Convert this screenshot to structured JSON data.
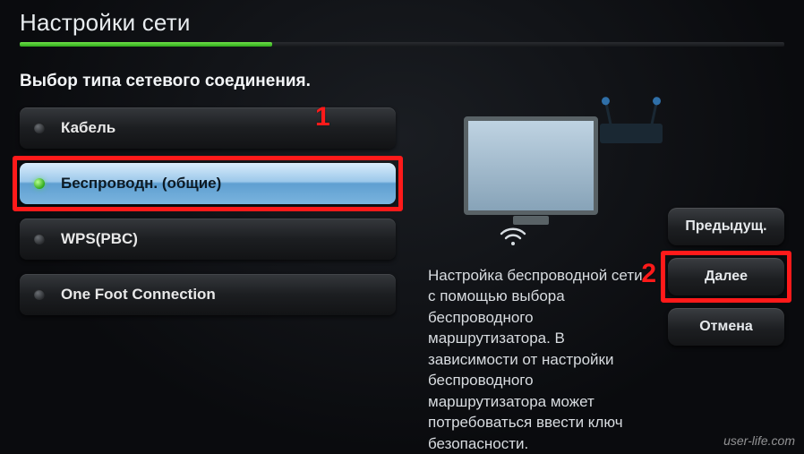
{
  "title": "Настройки сети",
  "subtitle": "Выбор типа сетевого соединения.",
  "options": [
    {
      "label": "Кабель",
      "selected": false
    },
    {
      "label": "Беспроводн. (общие)",
      "selected": true
    },
    {
      "label": "WPS(PBC)",
      "selected": false
    },
    {
      "label": "One Foot Connection",
      "selected": false
    }
  ],
  "description": "Настройка беспроводной сети с помощью выбора беспроводного маршрутизатора. В зависимости от настройки беспроводного маршрутизатора может потребоваться ввести ключ безопасности.",
  "buttons": {
    "prev": "Предыдущ.",
    "next": "Далее",
    "cancel": "Отмена"
  },
  "annotations": {
    "marker1": "1",
    "marker2": "2"
  },
  "icons": {
    "wifi": "wifi-icon",
    "monitor": "monitor-icon",
    "router": "router-icon"
  },
  "watermark": "user-life.com",
  "progress_percent": 33
}
